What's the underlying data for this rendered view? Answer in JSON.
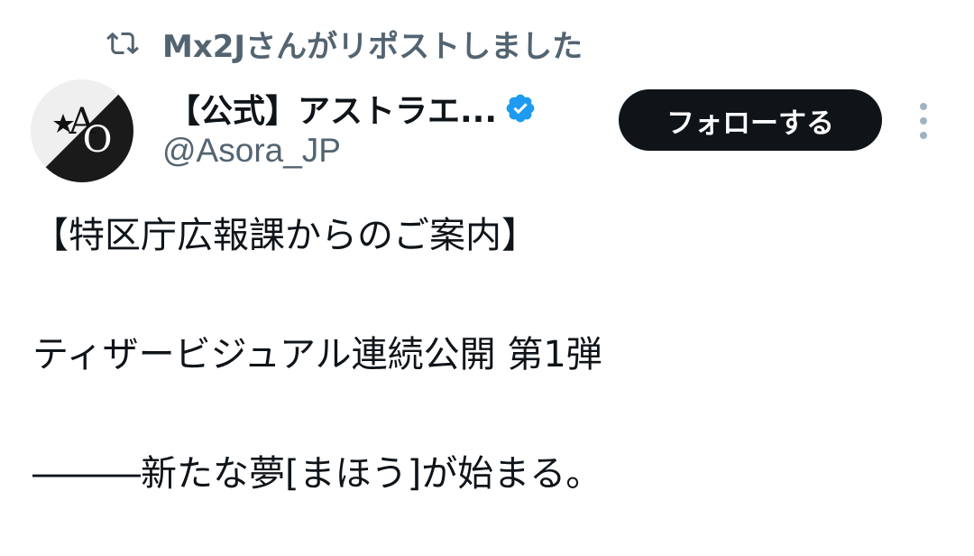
{
  "repost": {
    "icon": "repost-icon",
    "text": "Mx2Jさんがリポストしました"
  },
  "author": {
    "avatar_icon": "AO-logo-avatar",
    "display_name": "【公式】アストラエ...",
    "verified_icon": "verified-badge-icon",
    "handle": "@Asora_JP"
  },
  "actions": {
    "follow_label": "フォローする",
    "more_icon": "more-vertical-icon"
  },
  "tweet": {
    "line1": "【特区庁広報課からのご案内】",
    "line2": "ティザービジュアル連続公開 第1弾",
    "line3": "―――新たな夢[まほう]が始まる。"
  },
  "colors": {
    "text_primary": "#0f1419",
    "text_secondary": "#536471",
    "verified_blue": "#1d9bf0",
    "button_bg": "#0f1419"
  }
}
